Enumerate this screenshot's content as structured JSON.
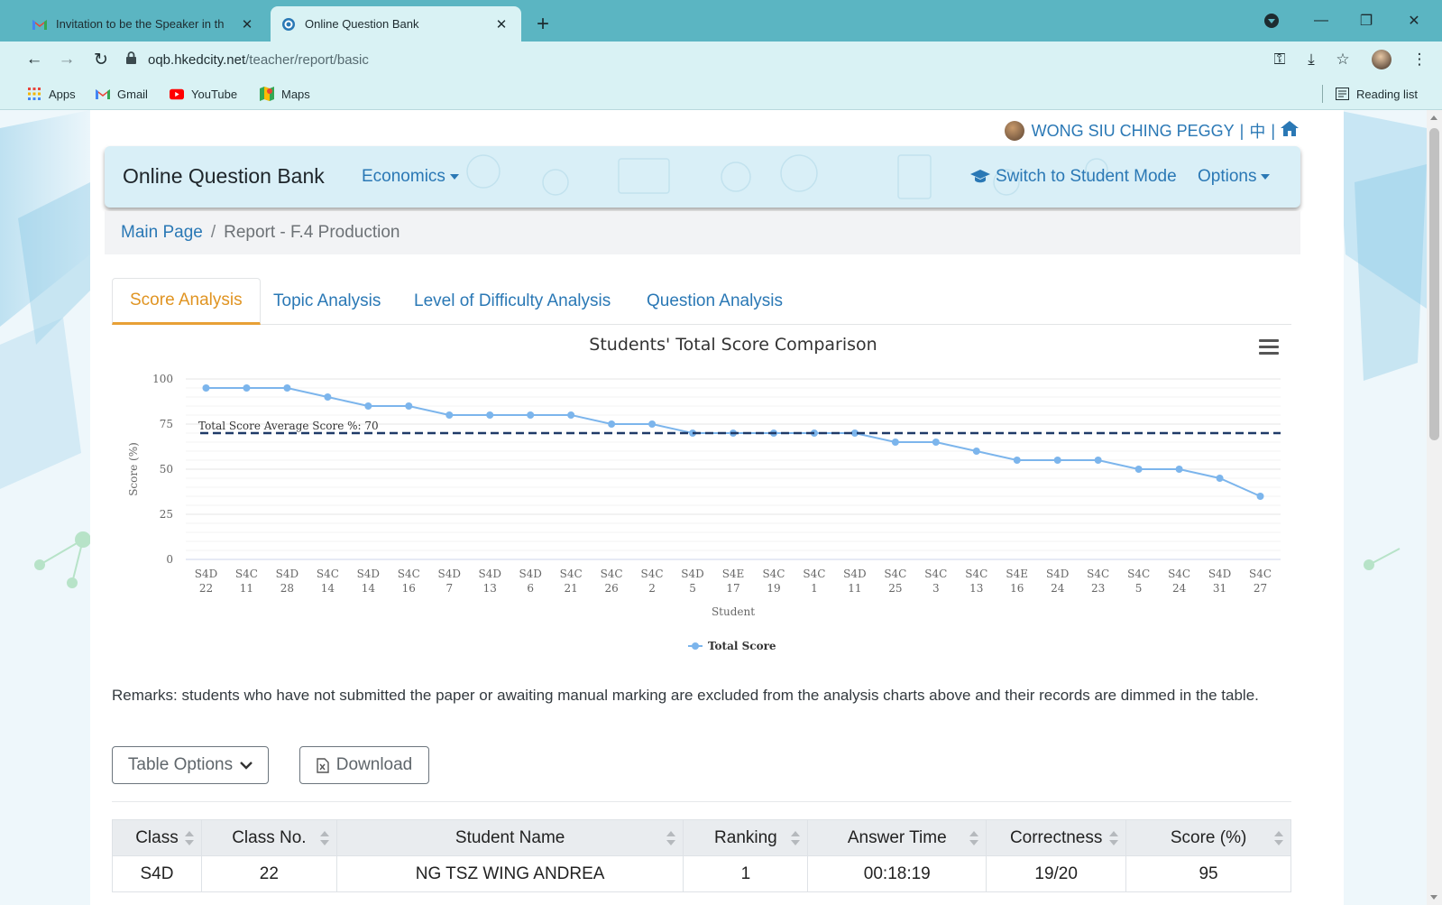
{
  "browser": {
    "tabs": [
      {
        "title": "Invitation to be the Speaker in th",
        "active": false
      },
      {
        "title": "Online Question Bank",
        "active": true
      }
    ],
    "url_host": "oqb.hkedcity.net",
    "url_path": "/teacher/report/basic",
    "bookmarks": [
      "Apps",
      "Gmail",
      "YouTube",
      "Maps"
    ],
    "reading_list": "Reading list"
  },
  "user": {
    "name": "WONG SIU CHING PEGGY",
    "lang": "中"
  },
  "header": {
    "brand": "Online Question Bank",
    "subject": "Economics",
    "switch_mode": "Switch to Student Mode",
    "options": "Options"
  },
  "breadcrumb": {
    "home": "Main Page",
    "current": "Report - F.4 Production"
  },
  "report_tabs": [
    "Score Analysis",
    "Topic Analysis",
    "Level of Difficulty Analysis",
    "Question Analysis"
  ],
  "chart_data": {
    "type": "line",
    "title": "Students' Total Score Comparison",
    "xlabel": "Student",
    "ylabel": "Score (%)",
    "ylim": [
      0,
      100
    ],
    "yticks": [
      0,
      25,
      50,
      75,
      100
    ],
    "categories": [
      [
        "S4D",
        "22"
      ],
      [
        "S4C",
        "11"
      ],
      [
        "S4D",
        "28"
      ],
      [
        "S4C",
        "14"
      ],
      [
        "S4D",
        "14"
      ],
      [
        "S4C",
        "16"
      ],
      [
        "S4D",
        "7"
      ],
      [
        "S4D",
        "13"
      ],
      [
        "S4D",
        "6"
      ],
      [
        "S4C",
        "21"
      ],
      [
        "S4C",
        "26"
      ],
      [
        "S4C",
        "2"
      ],
      [
        "S4D",
        "5"
      ],
      [
        "S4E",
        "17"
      ],
      [
        "S4C",
        "19"
      ],
      [
        "S4C",
        "1"
      ],
      [
        "S4D",
        "11"
      ],
      [
        "S4C",
        "25"
      ],
      [
        "S4C",
        "3"
      ],
      [
        "S4C",
        "13"
      ],
      [
        "S4E",
        "16"
      ],
      [
        "S4D",
        "24"
      ],
      [
        "S4C",
        "23"
      ],
      [
        "S4C",
        "5"
      ],
      [
        "S4C",
        "24"
      ],
      [
        "S4D",
        "31"
      ],
      [
        "S4C",
        "27"
      ]
    ],
    "series": [
      {
        "name": "Total Score",
        "color": "#7cb5ec",
        "values": [
          95,
          95,
          95,
          90,
          85,
          85,
          80,
          80,
          80,
          80,
          75,
          75,
          70,
          70,
          70,
          70,
          70,
          65,
          65,
          60,
          55,
          55,
          55,
          50,
          50,
          45,
          35
        ]
      }
    ],
    "average": {
      "label": "Total Score Average Score %: 70",
      "value": 70,
      "color": "#1f3a68"
    },
    "legend": "bottom-center",
    "grid": true
  },
  "remarks": "Remarks: students who have not submitted the paper or awaiting manual marking are excluded from the analysis charts above and their records are dimmed in the table.",
  "buttons": {
    "table_options": "Table Options",
    "download": "Download"
  },
  "table": {
    "columns": [
      "Class",
      "Class No.",
      "Student Name",
      "Ranking",
      "Answer Time",
      "Correctness",
      "Score (%)"
    ],
    "rows": [
      [
        "S4D",
        "22",
        "NG TSZ WING ANDREA",
        "1",
        "00:18:19",
        "19/20",
        "95"
      ]
    ]
  }
}
